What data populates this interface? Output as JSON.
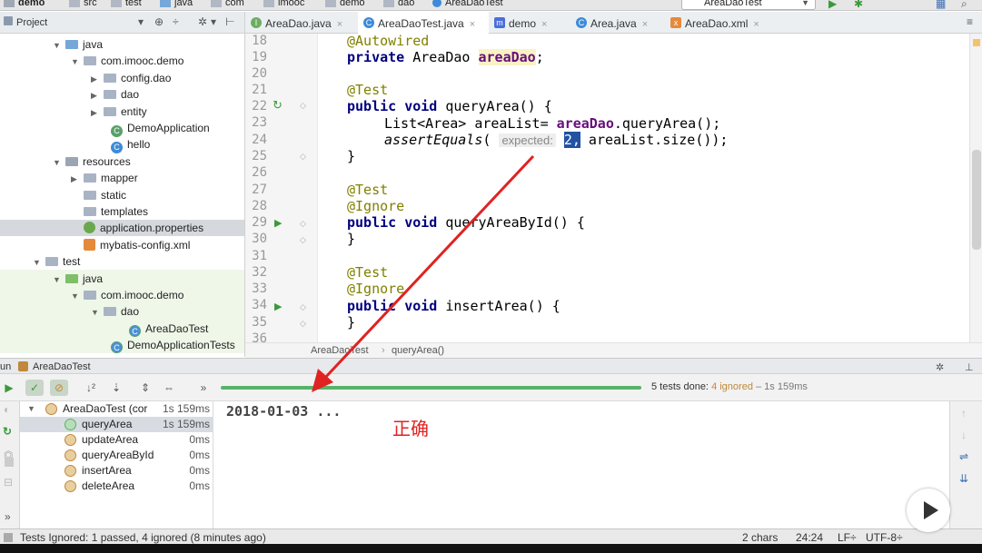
{
  "navbar": {
    "crumbs": [
      "demo",
      "src",
      "test",
      "java",
      "com",
      "imooc",
      "demo",
      "dao",
      "AreaDaoTest"
    ],
    "run_config": "AreaDaoTest"
  },
  "project_panel": {
    "title": "Project"
  },
  "tabs": [
    {
      "label": "AreaDao.java",
      "icon": "interface-icon",
      "color": "#6cae5f"
    },
    {
      "label": "AreaDaoTest.java",
      "icon": "class-icon",
      "color": "#3d8bd8",
      "active": true
    },
    {
      "label": "demo",
      "icon": "maven-icon",
      "color": "#4b6ed9"
    },
    {
      "label": "Area.java",
      "icon": "class-icon",
      "color": "#3d8bd8"
    },
    {
      "label": "AreaDao.xml",
      "icon": "xml-icon",
      "color": "#e58a3a"
    }
  ],
  "tree": [
    {
      "label": "java",
      "arrow": "▼",
      "icon": "source-folder-icon"
    },
    {
      "label": "com.imooc.demo",
      "arrow": "▼",
      "icon": "package-icon"
    },
    {
      "label": "config.dao",
      "arrow": "▶",
      "icon": "package-icon"
    },
    {
      "label": "dao",
      "arrow": "▶",
      "icon": "package-icon"
    },
    {
      "label": "entity",
      "arrow": "▶",
      "icon": "package-icon"
    },
    {
      "label": "DemoApplication",
      "arrow": "",
      "icon": "spring-class-icon"
    },
    {
      "label": "hello",
      "arrow": "",
      "icon": "class-icon"
    },
    {
      "label": "resources",
      "arrow": "▼",
      "icon": "resources-folder-icon"
    },
    {
      "label": "mapper",
      "arrow": "▶",
      "icon": "folder-icon"
    },
    {
      "label": "static",
      "arrow": "",
      "icon": "folder-icon"
    },
    {
      "label": "templates",
      "arrow": "",
      "icon": "folder-icon"
    },
    {
      "label": "application.properties",
      "arrow": "",
      "icon": "properties-icon",
      "selected": true
    },
    {
      "label": "mybatis-config.xml",
      "arrow": "",
      "icon": "xml-file-icon"
    },
    {
      "label": "test",
      "arrow": "▼",
      "icon": "folder-icon"
    },
    {
      "label": "java",
      "arrow": "▼",
      "icon": "test-source-folder-icon"
    },
    {
      "label": "com.imooc.demo",
      "arrow": "▼",
      "icon": "package-icon"
    },
    {
      "label": "dao",
      "arrow": "▼",
      "icon": "package-icon"
    },
    {
      "label": "AreaDaoTest",
      "arrow": "",
      "icon": "test-class-icon"
    },
    {
      "label": "DemoApplicationTests",
      "arrow": "",
      "icon": "test-class-icon"
    }
  ],
  "editor": {
    "line_numbers": [
      "18",
      "19",
      "20",
      "21",
      "22",
      "23",
      "24",
      "25",
      "26",
      "27",
      "28",
      "29",
      "30",
      "31",
      "32",
      "33",
      "34",
      "35",
      "36"
    ],
    "code": {
      "l18_annot": "@Autowired",
      "l19_kw": "private",
      "l19_type": " AreaDao ",
      "l19_field": "areaDao",
      "l19_end": ";",
      "l21_annot": "@Test",
      "l22_kw": "public void",
      "l22_rest": " queryArea() {",
      "l23_a": "List<Area> areaList= ",
      "l23_field": "areaDao",
      "l23_b": ".queryArea();",
      "l24_method": "assertEquals",
      "l24_paren": "( ",
      "l24_hint": "expected:",
      "l24_sel": "2,",
      "l24_rest": " areaList.size());",
      "l25": "}",
      "l27_annot": "@Test",
      "l28_annot": "@Ignore",
      "l29_kw": "public void",
      "l29_rest": " queryAreaById() {",
      "l30": "}",
      "l32_annot": "@Test",
      "l33_annot": "@Ignore",
      "l34_kw": "public void",
      "l34_rest": " insertArea() {",
      "l35": "}"
    },
    "breadcrumb": [
      "AreaDaoTest",
      "queryArea()"
    ]
  },
  "run_panel": {
    "label": "un",
    "config": "AreaDaoTest",
    "summary": "5 tests done:",
    "ignored": "4 ignored",
    "duration": "– 1s 159ms",
    "tests": [
      {
        "name": "AreaDaoTest (cor",
        "time": "1s 159ms",
        "status": "ignored",
        "root": true
      },
      {
        "name": "queryArea",
        "time": "1s 159ms",
        "status": "passed"
      },
      {
        "name": "updateArea",
        "time": "0ms",
        "status": "ignored"
      },
      {
        "name": "queryAreaById",
        "time": "0ms",
        "status": "ignored"
      },
      {
        "name": "insertArea",
        "time": "0ms",
        "status": "ignored"
      },
      {
        "name": "deleteArea",
        "time": "0ms",
        "status": "ignored"
      }
    ],
    "console_text": "2018-01-03 ..."
  },
  "annotation": {
    "text": "正确",
    "color": "#e02222"
  },
  "status_bar": {
    "message": "Tests Ignored: 1 passed, 4 ignored (8 minutes ago)",
    "chars": "2 chars",
    "position": "24:24",
    "line_sep": "LF÷",
    "encoding": "UTF-8÷"
  },
  "colors": {
    "accent": "#2152a3",
    "pass": "#58b368",
    "ignored": "#c0883a"
  }
}
